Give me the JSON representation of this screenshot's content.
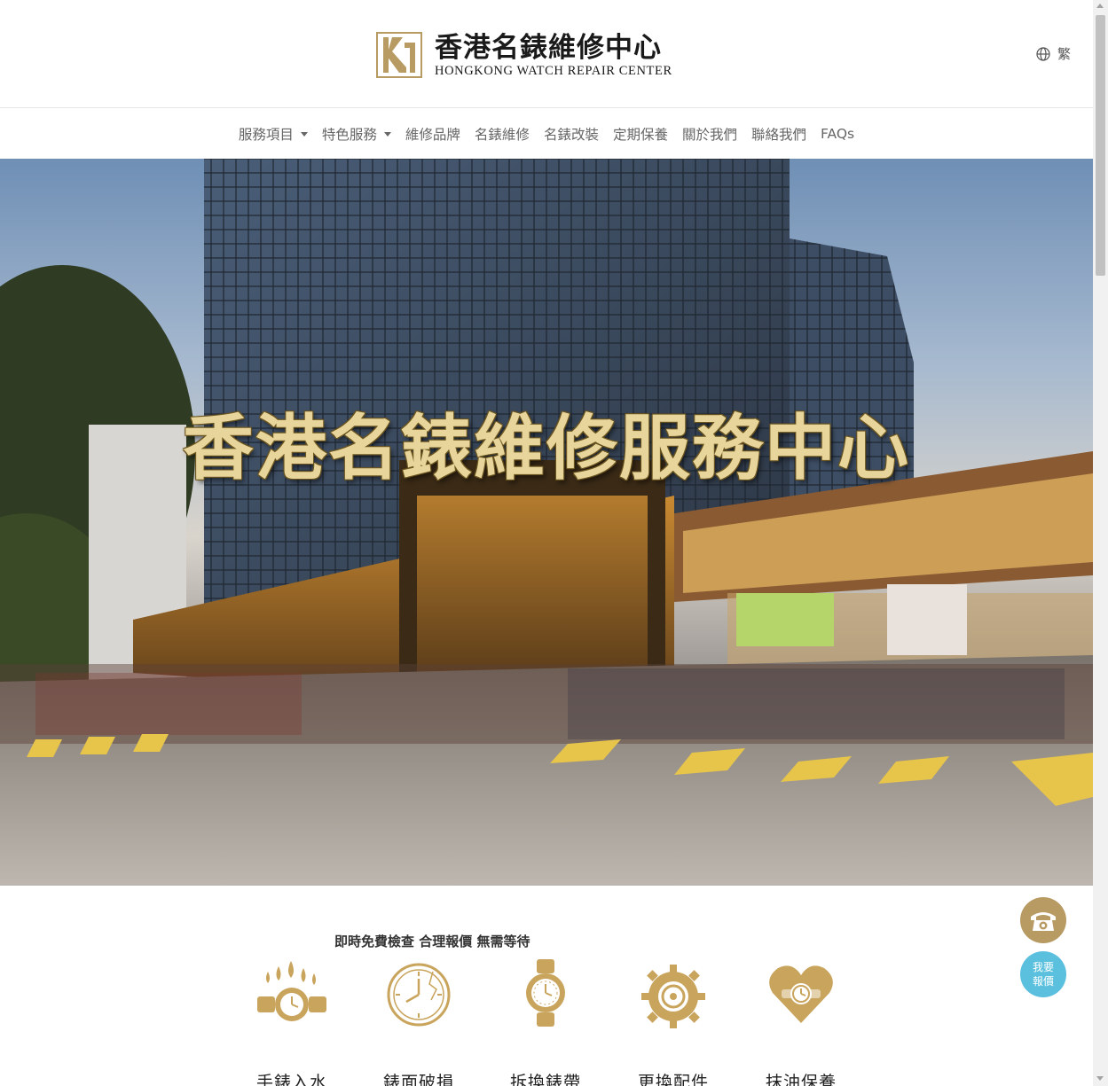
{
  "header": {
    "logo_cn": "香港名錶維修中心",
    "logo_en": "HONGKONG WATCH REPAIR CENTER",
    "lang_label": "繁"
  },
  "nav": {
    "items": [
      {
        "label": "服務項目",
        "dropdown": true
      },
      {
        "label": "特色服務",
        "dropdown": true
      },
      {
        "label": "維修品牌",
        "dropdown": false
      },
      {
        "label": "名錶維修",
        "dropdown": false
      },
      {
        "label": "名錶改裝",
        "dropdown": false
      },
      {
        "label": "定期保養",
        "dropdown": false
      },
      {
        "label": "關於我們",
        "dropdown": false
      },
      {
        "label": "聯絡我們",
        "dropdown": false
      },
      {
        "label": "FAQs",
        "dropdown": false
      }
    ]
  },
  "hero": {
    "title": "香港名錶維修服務中心"
  },
  "services": {
    "tagline": "即時免費檢查 合理報價 無需等待",
    "items": [
      {
        "label": "手錶入水",
        "icon": "water-drops-watch-icon"
      },
      {
        "label": "錶面破損",
        "icon": "cracked-clock-icon"
      },
      {
        "label": "拆換錶帶",
        "icon": "wristwatch-icon"
      },
      {
        "label": "更換配件",
        "icon": "gear-icon"
      },
      {
        "label": "抹油保養",
        "icon": "heart-watch-icon"
      }
    ]
  },
  "floating": {
    "phone_icon": "phone-icon",
    "quote_line1": "我要",
    "quote_line2": "報價"
  },
  "colors": {
    "gold": "#b89a63",
    "gold_light": "#e7d59b",
    "quote_blue": "#5bc0de"
  }
}
